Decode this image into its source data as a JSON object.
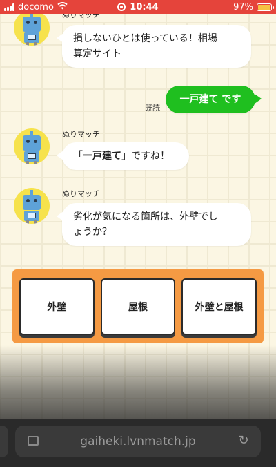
{
  "status_bar": {
    "carrier": "docomo",
    "time": "10:44",
    "battery": "97%"
  },
  "chat": {
    "messages": [
      {
        "sender": "ぬりマッチ",
        "text_line1": "損しないひとは使っている！相場",
        "text_line2": "算定サイト"
      },
      {
        "user_text": "一戸建て です",
        "read_label": "既読"
      },
      {
        "sender": "ぬりマッチ",
        "quote_open": "「",
        "bold": "一戸建て",
        "quote_close": "」",
        "rest": "ですね！"
      },
      {
        "sender": "ぬりマッチ",
        "text_line1": "劣化が気になる箇所は、外壁でし",
        "text_line2": "ょうか？"
      }
    ]
  },
  "options": [
    {
      "label": "外壁"
    },
    {
      "label": "屋根"
    },
    {
      "label": "外壁と屋根"
    }
  ],
  "browser": {
    "url": "gaiheki.lvnmatch.jp"
  },
  "colors": {
    "status_bar": "#e5443b",
    "user_bubble": "#1fbf1f",
    "options_panel": "#f59a43",
    "avatar_bg": "#f6e24c"
  }
}
